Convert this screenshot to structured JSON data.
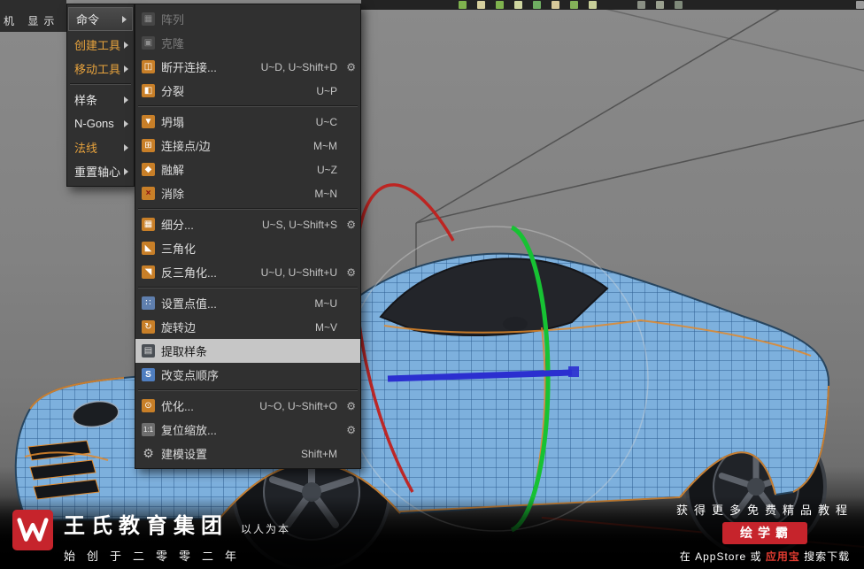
{
  "window": {
    "topleft_text": "机 显示"
  },
  "colors": {
    "menu_bg": "#303030",
    "menu_highlight": "#c6c6c6",
    "accent_orange": "#e8a33d",
    "icon_orange": "#c87f28",
    "brand_red": "#c6242c",
    "wireframe_blue": "#7db0dd",
    "gizmo_green": "#17c233",
    "gizmo_red": "#c0201c",
    "axis_blue": "#2b2fd0"
  },
  "topbar": {
    "icons": [
      "background:#7fb24e",
      "background:#d6cf9e",
      "background:#7fb24e",
      "background:#cfd6a0",
      "background:#6fae62",
      "background:#d8c89a",
      "background:#84b259",
      "background:#c9d09a",
      "margin-left:34px;background:#8a8f84",
      "background:#9aa08f",
      "background:#7f8a7a",
      "margin-left:auto;background:#9a9a9a"
    ]
  },
  "primary_menu": {
    "items": [
      {
        "label": "命令",
        "label_style": "color:#ececec"
      },
      {
        "label": "创建工具",
        "label_style": "color:#e8a33d"
      },
      {
        "label": "移动工具",
        "label_style": "color:#e8a33d"
      },
      {
        "label": "样条",
        "label_style": "color:#e6e6e6"
      },
      {
        "label": "N-Gons",
        "label_style": "color:#e6e6e6"
      },
      {
        "label": "法线",
        "label_style": "color:#e8a33d"
      },
      {
        "label": "重置轴心",
        "label_style": "color:#e6e6e6"
      }
    ]
  },
  "submenu": {
    "items": [
      {
        "label": "阵列",
        "shortcut": "",
        "glyph": "▦",
        "icon_style": "background:#464646;color:#8e8e8e",
        "gear": ""
      },
      {
        "label": "克隆",
        "shortcut": "",
        "glyph": "▣",
        "icon_style": "background:#464646;color:#8e8e8e",
        "gear": ""
      },
      {
        "label": "断开连接...",
        "shortcut": "U~D, U~Shift+D",
        "glyph": "◫",
        "icon_style": "background:#c87f28;color:#fff",
        "gear": "⚙"
      },
      {
        "label": "分裂",
        "shortcut": "U~P",
        "glyph": "◧",
        "icon_style": "background:#c87f28;color:#fff",
        "gear": ""
      },
      {
        "label": "坍塌",
        "shortcut": "U~C",
        "glyph": "▼",
        "icon_style": "background:#c87f28;color:#fff",
        "gear": ""
      },
      {
        "label": "连接点/边",
        "shortcut": "M~M",
        "glyph": "⊞",
        "icon_style": "background:#c87f28;color:#fff",
        "gear": ""
      },
      {
        "label": "融解",
        "shortcut": "U~Z",
        "glyph": "◆",
        "icon_style": "background:#c87f28;color:#fff",
        "gear": ""
      },
      {
        "label": "消除",
        "shortcut": "M~N",
        "glyph": "×",
        "icon_style": "background:#c87f28;color:#8a1010;font-weight:bold",
        "gear": ""
      },
      {
        "label": "细分...",
        "shortcut": "U~S, U~Shift+S",
        "glyph": "▦",
        "icon_style": "background:#c87f28;color:#fff",
        "gear": "⚙"
      },
      {
        "label": "三角化",
        "shortcut": "",
        "glyph": "◣",
        "icon_style": "background:#c87f28;color:#fff",
        "gear": ""
      },
      {
        "label": "反三角化...",
        "shortcut": "U~U, U~Shift+U",
        "glyph": "◥",
        "icon_style": "background:#c87f28;color:#fff",
        "gear": "⚙"
      },
      {
        "label": "设置点值...",
        "shortcut": "M~U",
        "glyph": "∷",
        "icon_style": "background:#5f7fae;color:#fff",
        "gear": ""
      },
      {
        "label": "旋转边",
        "shortcut": "M~V",
        "glyph": "↻",
        "icon_style": "background:#c87f28;color:#fff",
        "gear": ""
      },
      {
        "label": "提取样条",
        "shortcut": "",
        "glyph": "▤",
        "icon_style": "background:#4a4f55;color:#ddd",
        "gear": ""
      },
      {
        "label": "改变点顺序",
        "shortcut": "",
        "glyph": "S",
        "icon_style": "background:#4f7ec0;color:#fff;font-weight:bold",
        "gear": ""
      },
      {
        "label": "优化...",
        "shortcut": "U~O, U~Shift+O",
        "glyph": "⊙",
        "icon_style": "background:#c87f28;color:#fff",
        "gear": "⚙"
      },
      {
        "label": "复位缩放...",
        "shortcut": "",
        "glyph": "1:1",
        "icon_style": "background:#6e6e6e;color:#f0f0f0;font-size:8px",
        "gear": "⚙"
      },
      {
        "label": "建模设置",
        "shortcut": "Shift+M",
        "glyph": "⚙",
        "icon_style": "background:transparent;color:#c2c2c2;font-size:14px",
        "gear": ""
      }
    ]
  },
  "branding": {
    "company": "王氏教育集团",
    "slogan": "以人为本",
    "founded": "始创于二零零二年"
  },
  "promo": {
    "line1": "获得更多免费精品教程",
    "badge": "绘学霸",
    "line3_pre": "在 AppStore 或 ",
    "line3_highlight": "应用宝",
    "line3_post": " 搜索下载"
  }
}
